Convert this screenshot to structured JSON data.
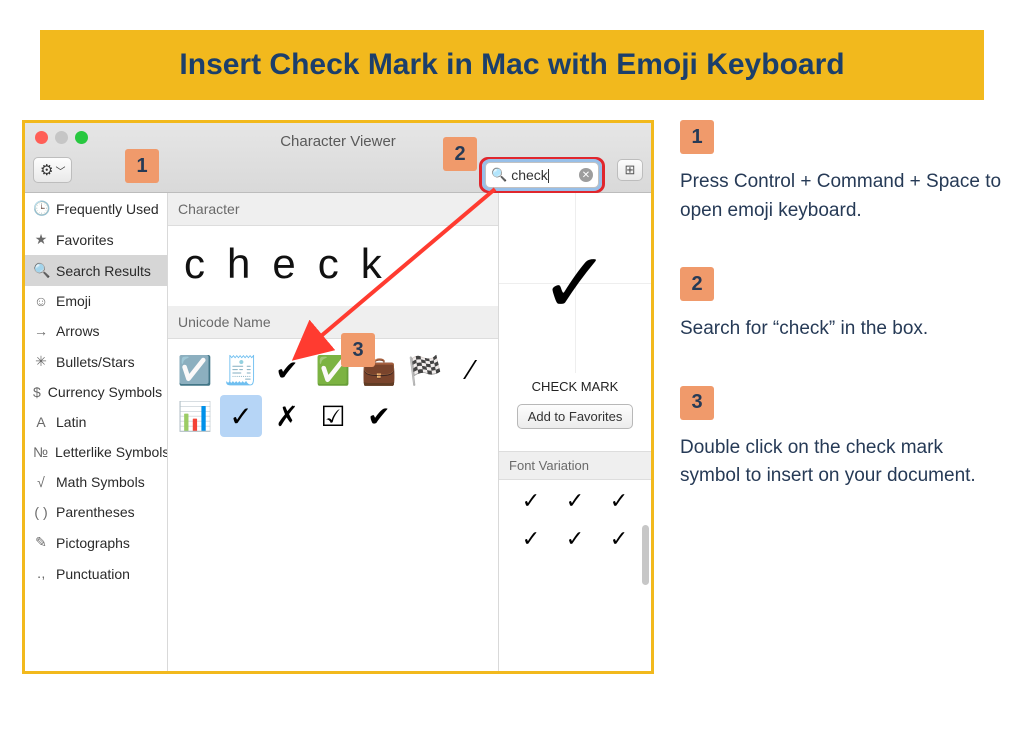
{
  "banner": {
    "title": "Insert Check Mark in Mac with Emoji Keyboard"
  },
  "window": {
    "title": "Character Viewer",
    "search_value": "check",
    "character_header": "Character",
    "character_display": "check",
    "unicode_header": "Unicode Name",
    "preview_glyph": "✓",
    "preview_name": "CHECK MARK",
    "favorite_button": "Add to Favorites",
    "font_variation_header": "Font Variation"
  },
  "sidebar": {
    "items": [
      {
        "icon": "🕒",
        "label": "Frequently Used"
      },
      {
        "icon": "★",
        "label": "Favorites"
      },
      {
        "icon": "🔍",
        "label": "Search Results"
      },
      {
        "icon": "☺",
        "label": "Emoji"
      },
      {
        "icon": "→",
        "label": "Arrows"
      },
      {
        "icon": "✳",
        "label": "Bullets/Stars"
      },
      {
        "icon": "$",
        "label": "Currency Symbols"
      },
      {
        "icon": "A",
        "label": "Latin"
      },
      {
        "icon": "№",
        "label": "Letterlike Symbols"
      },
      {
        "icon": "√",
        "label": "Math Symbols"
      },
      {
        "icon": "( )",
        "label": "Parentheses"
      },
      {
        "icon": "✎",
        "label": "Pictographs"
      },
      {
        "icon": "․,",
        "label": "Punctuation"
      }
    ]
  },
  "results": {
    "row1": [
      "☑️",
      "🧾",
      "✔",
      "✅",
      "💼",
      "🏁",
      "⁄"
    ],
    "row2": [
      "📊",
      "✓",
      "✗",
      "☑",
      "✔"
    ]
  },
  "font_variations": [
    "✓",
    "✓",
    "✓",
    "✓",
    "✓",
    "✓"
  ],
  "callouts": {
    "one": "1",
    "two": "2",
    "three": "3"
  },
  "steps": {
    "s1": "Press Control + Command + Space to open emoji keyboard.",
    "s2": "Search for “check” in the box.",
    "s3": "Double click on the check mark symbol to insert on your document."
  }
}
